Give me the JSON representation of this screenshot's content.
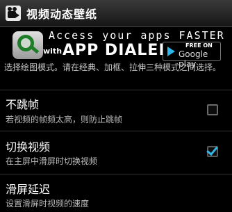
{
  "header": {
    "title": "视频动态壁纸",
    "icon": "film-camera-icon"
  },
  "ad": {
    "headline": "Access your apps FASTER",
    "with_text": "with",
    "brand": "APP DIALER",
    "badge_top": "FREE ON",
    "badge_store": "Google play",
    "logo_icon": "magnifier-logo-icon"
  },
  "intro_text": "选择绘图模式。请在经典、加框、拉伸三种模式之间选择。",
  "settings": [
    {
      "title": "不跳帧",
      "subtitle": "若视频的帧频太高，则防止跳帧",
      "checked": "false"
    },
    {
      "title": "切换视频",
      "subtitle": "在主屏中滑屏时切换视频",
      "checked": "true"
    },
    {
      "title": "滑屏延迟",
      "subtitle": "设置滑屏时视频的速度"
    }
  ],
  "colors": {
    "accent": "#33b5e5",
    "background": "#000000"
  }
}
